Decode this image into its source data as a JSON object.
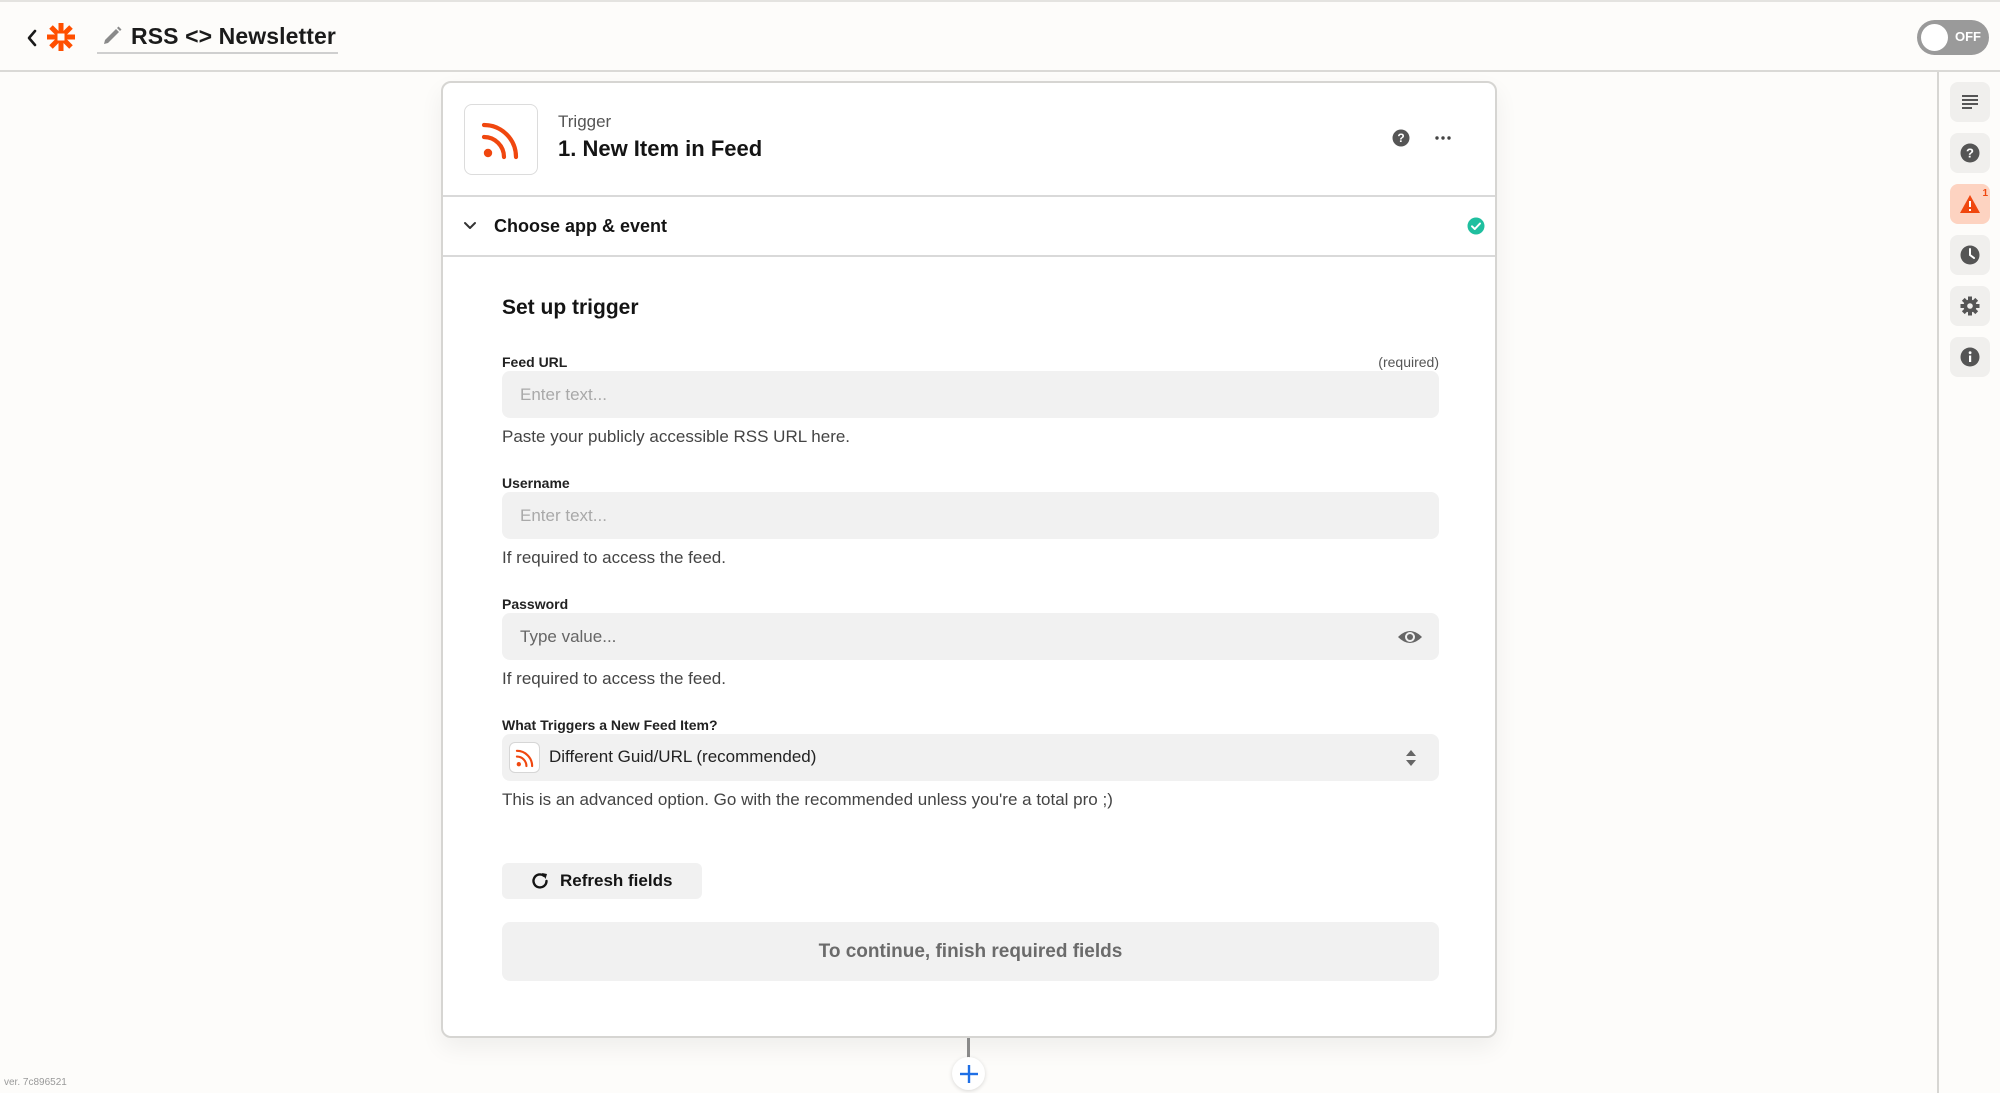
{
  "header": {
    "zap_title": "RSS <> Newsletter",
    "toggle_label": "OFF",
    "toggle_on": false
  },
  "sidebar": {
    "items": [
      {
        "icon": "outline-icon",
        "label": "Outline"
      },
      {
        "icon": "help-icon",
        "label": "Help"
      },
      {
        "icon": "warning-icon",
        "label": "Alerts",
        "badge": "1"
      },
      {
        "icon": "history-icon",
        "label": "History"
      },
      {
        "icon": "settings-icon",
        "label": "Settings"
      },
      {
        "icon": "info-icon",
        "label": "Details"
      }
    ]
  },
  "step": {
    "type_label": "Trigger",
    "title": "1. New Item in Feed",
    "app_icon": "rss-icon",
    "section_title": "Choose app & event",
    "section_complete": true
  },
  "form": {
    "title": "Set up trigger",
    "fields": [
      {
        "label": "Feed URL",
        "required_label": "(required)",
        "placeholder": "Enter text...",
        "value": "",
        "help": "Paste your publicly accessible RSS URL here."
      },
      {
        "label": "Username",
        "placeholder": "Enter text...",
        "value": "",
        "help": "If required to access the feed."
      },
      {
        "label": "Password",
        "placeholder": "Type value...",
        "value": "",
        "help": "If required to access the feed."
      },
      {
        "label": "What Triggers a New Feed Item?",
        "selected": "Different Guid/URL (recommended)",
        "help": "This is an advanced option. Go with the recommended unless you're a total pro ;)"
      }
    ],
    "refresh_label": "Refresh fields",
    "continue_label": "To continue, finish required fields"
  },
  "footer": {
    "version": "ver. 7c896521"
  },
  "colors": {
    "brand": "#ff4f00",
    "success": "#1fbf9f",
    "alert_bg": "#fdd3c1",
    "add_blue": "#1f6fe5"
  }
}
